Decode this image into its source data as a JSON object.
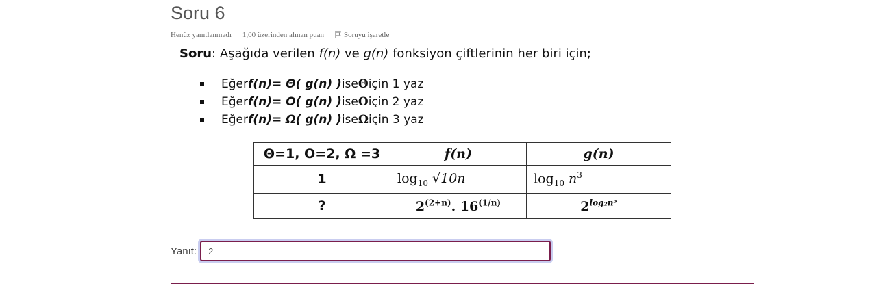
{
  "question": {
    "title": "Soru 6",
    "status": "Henüz yanıtlanmadı",
    "points": "1,00 üzerinden alınan puan",
    "flag_label": "Soruyu işaretle"
  },
  "prompt": {
    "bold": "Soru",
    "text1": ": Aşağıda verilen ",
    "f": "f(n)",
    "text2": " ve ",
    "g": "g(n)",
    "text3": " fonksiyon çiftlerinin her biri için;"
  },
  "bullets": [
    {
      "pre": "Eğer ",
      "expr": "f(n)= Θ( g(n) )",
      "mid": " ise ",
      "sym": "Θ",
      "post": " için 1 yaz"
    },
    {
      "pre": "Eğer ",
      "expr": "f(n)= O( g(n) )",
      "mid": " ise ",
      "sym": "O",
      "post": " için 2 yaz"
    },
    {
      "pre": "Eğer ",
      "expr": "f(n)= Ω( g(n) )",
      "mid": " ise ",
      "sym": "Ω",
      "post": " için 3 yaz"
    }
  ],
  "table": {
    "headers": [
      "Θ=1, O=2, Ω =3",
      "f(n)",
      "g(n)"
    ],
    "rows": [
      {
        "label": "1",
        "f_base": "log",
        "f_sub": "10",
        "f_rest": " √10n",
        "g_base": "log",
        "g_sub": "10",
        "g_rest": " n",
        "g_sup": "3"
      },
      {
        "label": "?",
        "f_a": "2",
        "f_a_sup": "(2+n)",
        "f_mid": ". 16",
        "f_b_sup": "(1/n)",
        "g_a": "2",
        "g_sup": "log₂n³"
      }
    ]
  },
  "answer": {
    "label": "Yanıt:",
    "value": "2"
  }
}
